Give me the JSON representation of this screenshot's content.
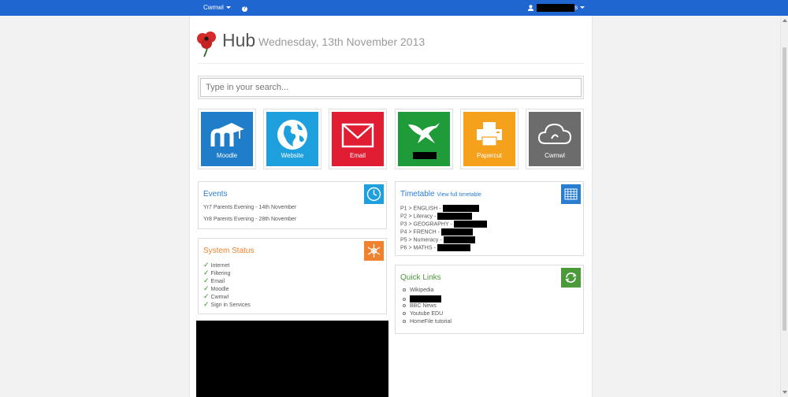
{
  "navbar": {
    "brand": "Cwmwl",
    "help": "?",
    "user_suffix": "s"
  },
  "header": {
    "title": "Hub",
    "date": "Wednesday, 13th November 2013"
  },
  "search": {
    "placeholder": "Type in your search..."
  },
  "tiles": [
    {
      "label": "Moodle",
      "color": "#1f7dc9",
      "icon": "moodle-icon"
    },
    {
      "label": "Website",
      "color": "#1ea0df",
      "icon": "globe-icon"
    },
    {
      "label": "Email",
      "color": "#e11d33",
      "icon": "envelope-icon"
    },
    {
      "label": "",
      "color": "#1f9b3a",
      "icon": "eagle-icon"
    },
    {
      "label": "Papercut",
      "color": "#f5a11c",
      "icon": "printer-icon"
    },
    {
      "label": "Cwmwl",
      "color": "#6c6c6c",
      "icon": "cloud-icon"
    }
  ],
  "events": {
    "title": "Events",
    "color": "#2a7ed1",
    "items": [
      "Yr7 Parents Evening - 14th November",
      "Yr8 Parents Evening - 28th November"
    ]
  },
  "timetable": {
    "title": "Timetable",
    "link": "View full timetable",
    "color": "#2a7ed1",
    "items": [
      "P1 > ENGLISH -",
      "P2 > Literacy -",
      "P3 > GEOGRAPHY -",
      "P4 > FRENCH -",
      "P5 > Numeracy -",
      "P6 > MATHS -"
    ]
  },
  "system_status": {
    "title": "System Status",
    "color": "#f0822f",
    "items": [
      "Internet",
      "Filtering",
      "Email",
      "Moodle",
      "Cwmwl",
      "Sign in Services"
    ]
  },
  "quick_links": {
    "title": "Quick Links",
    "color": "#4a9a3a",
    "items": [
      "Wikipedia",
      "",
      "BBC News",
      "Youtube EDU",
      "HomeFile tutorial"
    ]
  }
}
